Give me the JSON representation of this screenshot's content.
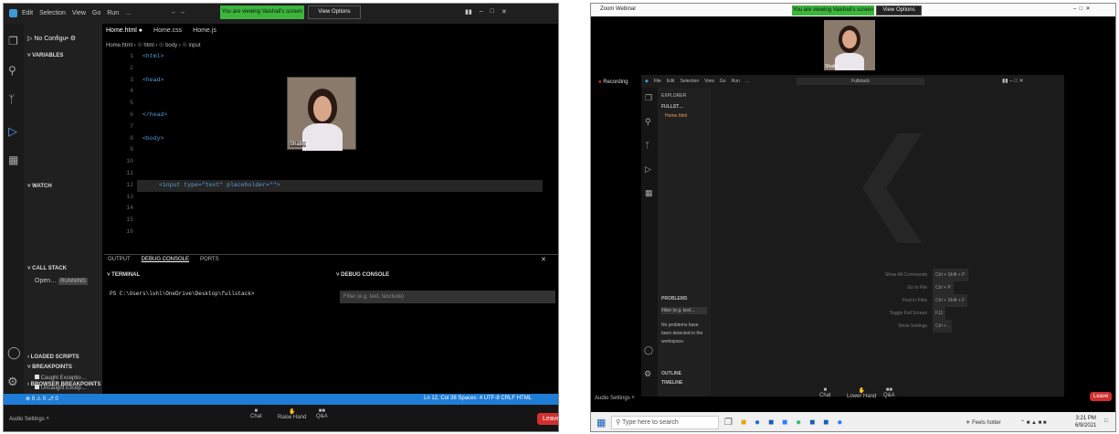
{
  "left": {
    "titlebar": {
      "menu": [
        "Edit",
        "Selection",
        "View",
        "Go",
        "Run",
        "…"
      ],
      "share_notice": "You are viewing Vaishali's screen",
      "view_options": "View Options"
    },
    "debug_toolbar": {
      "config": "No Configu•",
      "tabs": [
        "Home.html ●",
        "Home.css",
        "Home.js"
      ]
    },
    "breadcrumb": "Home.html › ☉ html › ☉ body › ☉ input",
    "sidebar": {
      "variables": "VARIABLES",
      "watch": "WATCH",
      "call_stack": "CALL STACK",
      "call_item": "Open…",
      "call_item_badge": "RUNNING",
      "loaded_scripts": "LOADED SCRIPTS",
      "breakpoints": "BREAKPOINTS",
      "bp1": "Caught Exceptio…",
      "bp2": "Uncaught Excep…",
      "browser_bp": "BROWSER BREAKPOINTS"
    },
    "code": {
      "lines": [
        {
          "n": "1",
          "t": "<html>"
        },
        {
          "n": "2",
          "t": ""
        },
        {
          "n": "3",
          "t": "<head>"
        },
        {
          "n": "4",
          "t": ""
        },
        {
          "n": "5",
          "t": ""
        },
        {
          "n": "6",
          "t": "</head>"
        },
        {
          "n": "7",
          "t": ""
        },
        {
          "n": "8",
          "t": "<body>"
        },
        {
          "n": "9",
          "t": ""
        },
        {
          "n": "10",
          "t": ""
        },
        {
          "n": "11",
          "t": ""
        },
        {
          "n": "12",
          "t": "<input type=\"text\" placeholder=\"\">"
        },
        {
          "n": "13",
          "t": ""
        },
        {
          "n": "14",
          "t": ""
        },
        {
          "n": "15",
          "t": ""
        },
        {
          "n": "16",
          "t": ""
        }
      ]
    },
    "video_name": "Shalini",
    "panel": {
      "tabs": [
        "OUTPUT",
        "DEBUG CONSOLE",
        "PORTS"
      ],
      "terminal_title": "TERMINAL",
      "debug_title": "DEBUG CONSOLE",
      "prompt": "PS C:\\Users\\lshl\\OneDrive\\Desktop\\fullstack>",
      "filter_placeholder": "Filter (e.g. text, !exclude)"
    },
    "statusbar": {
      "left": "⊗ 0 ⚠ 0   ⎇ 0",
      "right": "Ln 12, Col 38   Spaces: 4   UTF-8   CRLF   HTML"
    },
    "zoom": {
      "audio": "Audio Settings ˄",
      "chat": "Chat",
      "raise": "Raise Hand",
      "qa": "Q&A",
      "leave": "Leave"
    }
  },
  "right": {
    "window_title": "Zoom Webinar",
    "share_notice": "You are viewing Vaishali's screen",
    "view_options": "View Options",
    "video_name": "Shalini",
    "recording": "Recording",
    "vscode": {
      "menu": [
        "File",
        "Edit",
        "Selection",
        "View",
        "Go",
        "Run",
        "…"
      ],
      "search": "Fullstack",
      "explorer_title": "EXPLORER",
      "folder": "FULLST…",
      "file": "Home.html",
      "problems_title": "PROBLEMS",
      "problems_filter": "Filter (e.g. text…",
      "problems_msg": "No problems have been detected in the workspace.",
      "outline": "OUTLINE",
      "timeline": "TIMELINE",
      "shortcuts": [
        {
          "label": "Show All Commands",
          "keys": "Ctrl + Shift + P"
        },
        {
          "label": "Go to File",
          "keys": "Ctrl + P"
        },
        {
          "label": "Find in Files",
          "keys": "Ctrl + Shift + F"
        },
        {
          "label": "Toggle Full Screen",
          "keys": "F11"
        },
        {
          "label": "Show Settings",
          "keys": "Ctrl + ,"
        }
      ]
    },
    "zoom": {
      "audio": "Audio Settings ˄",
      "chat": "Chat",
      "raise": "Lower Hand",
      "qa": "Q&A",
      "leave": "Leave"
    },
    "taskbar": {
      "search": "Type here to search",
      "weather": "Feels hotter",
      "time": "3:21 PM",
      "date": "6/9/2021"
    }
  }
}
